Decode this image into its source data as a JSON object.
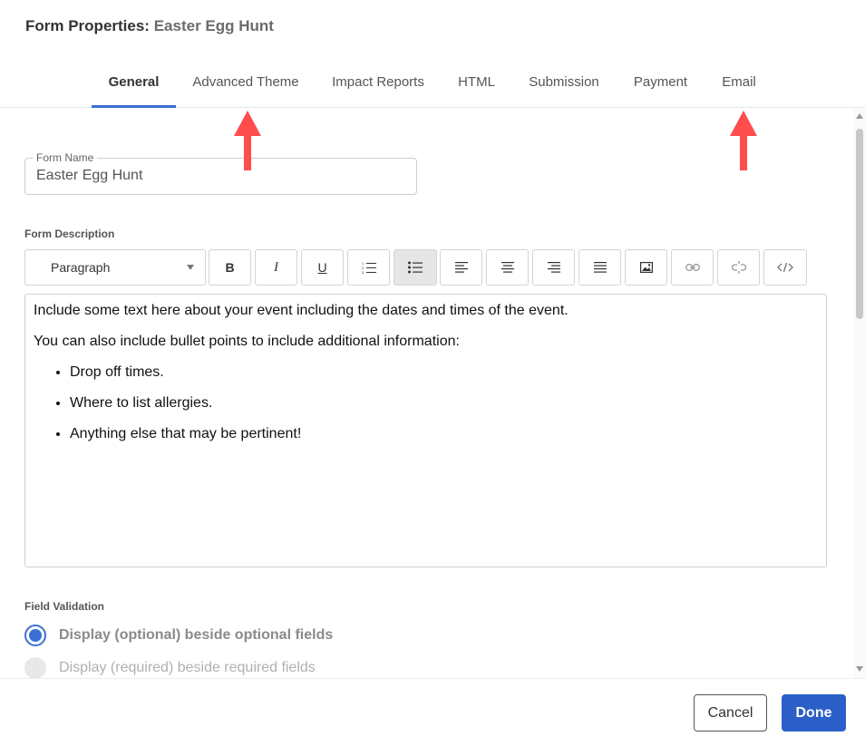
{
  "header": {
    "prefix": "Form Properties:",
    "form_name": "Easter Egg Hunt"
  },
  "tabs": [
    {
      "label": "General",
      "active": true
    },
    {
      "label": "Advanced Theme"
    },
    {
      "label": "Impact Reports"
    },
    {
      "label": "HTML"
    },
    {
      "label": "Submission"
    },
    {
      "label": "Payment"
    },
    {
      "label": "Email"
    }
  ],
  "annotation_color": "#ff4d4d",
  "accent_color": "#3b6fd4",
  "form_name_field": {
    "label": "Form Name",
    "value": "Easter Egg Hunt"
  },
  "description": {
    "label": "Form Description",
    "toolbar": {
      "block_format": "Paragraph",
      "buttons": [
        "bold-icon",
        "italic-icon",
        "underline-icon",
        "numbered-list-icon",
        "bulleted-list-icon",
        "align-left-icon",
        "align-center-icon",
        "align-right-icon",
        "justify-icon",
        "image-icon",
        "link-icon",
        "unlink-icon",
        "code-icon"
      ]
    },
    "paragraphs": [
      "Include some text here about your event including the dates and times of the event.",
      "You can also include bullet points to include additional information:"
    ],
    "bullets": [
      "Drop off times.",
      "Where to list allergies.",
      "Anything else that may be pertinent!"
    ]
  },
  "field_validation": {
    "label": "Field Validation",
    "options": [
      {
        "label": "Display (optional) beside optional fields",
        "selected": true
      },
      {
        "label": "Display (required) beside required fields",
        "selected": false
      }
    ]
  },
  "footer": {
    "cancel_label": "Cancel",
    "done_label": "Done"
  }
}
